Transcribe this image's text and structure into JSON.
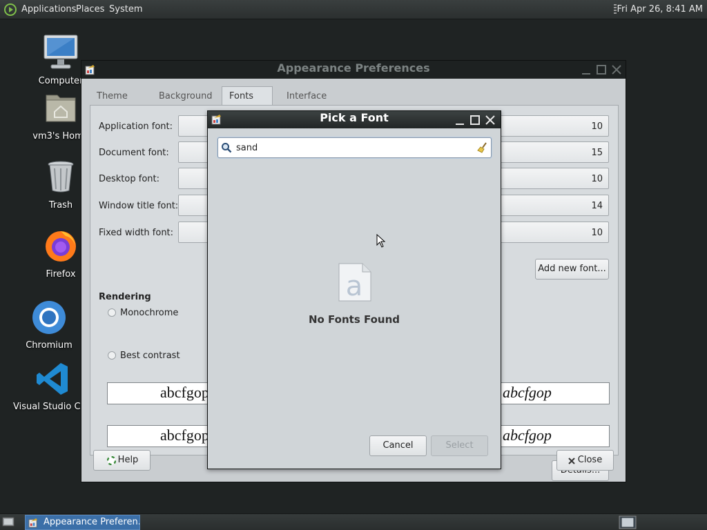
{
  "top_panel": {
    "menus": [
      "Applications",
      "Places",
      "System"
    ],
    "clock": "Fri Apr 26,  8:41 AM"
  },
  "desktop_icons": [
    {
      "label": "Computer",
      "icon": "computer-icon"
    },
    {
      "label": "vm3's Home",
      "icon": "home-folder-icon"
    },
    {
      "label": "Trash",
      "icon": "trash-icon"
    },
    {
      "label": "Firefox",
      "icon": "firefox-icon"
    },
    {
      "label": "Chromium",
      "icon": "chromium-icon"
    },
    {
      "label": "Visual Studio Code",
      "icon": "vscode-icon"
    }
  ],
  "appearance": {
    "title": "Appearance Preferences",
    "tabs": [
      "Theme",
      "Background",
      "Fonts",
      "Interface"
    ],
    "active_tab": "Fonts",
    "fonts": [
      {
        "label": "Application font:",
        "size": "10"
      },
      {
        "label": "Document font:",
        "size": "15"
      },
      {
        "label": "Desktop font:",
        "size": "10"
      },
      {
        "label": "Window title font:",
        "size": "14"
      },
      {
        "label": "Fixed width font:",
        "size": "10"
      }
    ],
    "add_font_label": "Add new font...",
    "rendering_title": "Rendering",
    "rendering_options": [
      {
        "label": "Monochrome",
        "preview": "abcfgop",
        "checked": false
      },
      {
        "label": "Best contrast",
        "preview": "abcfgop",
        "checked": false
      }
    ],
    "details_label": "Details...",
    "help_label": "Help",
    "close_label": "Close"
  },
  "font_dialog": {
    "title": "Pick a Font",
    "search_value": "sand",
    "empty_message": "No Fonts Found",
    "cancel_label": "Cancel",
    "select_label": "Select"
  },
  "taskbar": {
    "task_label": "Appearance Preferen..."
  },
  "colors": {
    "desktop_bg": "#1f2323",
    "titlebar_dark": "#1d2121",
    "task_active": "#3b6fa8"
  }
}
